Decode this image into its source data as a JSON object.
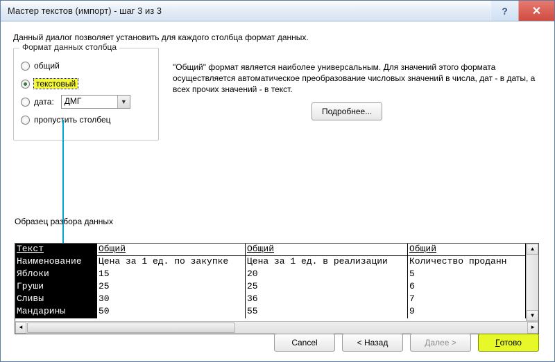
{
  "window": {
    "title": "Мастер текстов (импорт) - шаг 3 из 3"
  },
  "intro": "Данный диалог позволяет установить для каждого столбца формат данных.",
  "format_group": {
    "legend": "Формат данных столбца",
    "general": "общий",
    "text": "текстовый",
    "date": "дата:",
    "date_value": "ДМГ",
    "skip": "пропустить столбец"
  },
  "description": "\"Общий\" формат является наиболее универсальным. Для значений этого формата осуществляется автоматическое преобразование числовых значений в числа, дат - в даты, а всех прочих значений - в текст.",
  "more_button": "Подробнее...",
  "sample": {
    "label": "Образец разбора данных",
    "headers": [
      "Текст",
      "Общий",
      "Общий",
      "Общий"
    ],
    "rows": [
      [
        "Наименование",
        "Цена за 1 ед. по закупке",
        "Цена за 1 ед. в реализации",
        "Количество проданн"
      ],
      [
        "Яблоки",
        "15",
        "20",
        "5"
      ],
      [
        "Груши",
        "25",
        "25",
        "6"
      ],
      [
        "Сливы",
        "30",
        "36",
        "7"
      ],
      [
        "Мандарины",
        "50",
        "55",
        "9"
      ]
    ]
  },
  "footer": {
    "cancel": "Cancel",
    "back": "< Назад",
    "next": "Далее >",
    "finish": "Готово"
  }
}
